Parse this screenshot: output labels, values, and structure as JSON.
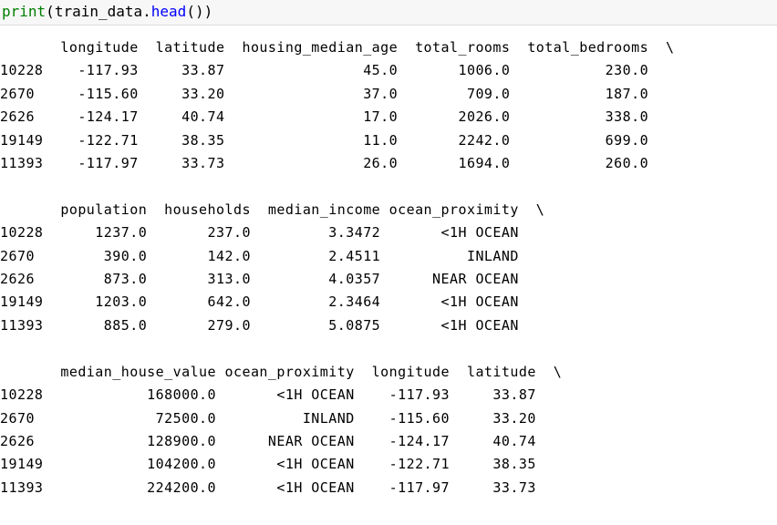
{
  "input": {
    "print": "print",
    "open_paren": "(",
    "obj": "train_data",
    "dot": ".",
    "method": "head",
    "close": "())"
  },
  "output": {
    "blocks": [
      {
        "header": "       longitude  latitude  housing_median_age  total_rooms  total_bedrooms  \\",
        "rows": [
          "10228    -117.93     33.87                45.0       1006.0           230.0   ",
          "2670     -115.60     33.20                37.0        709.0           187.0   ",
          "2626     -124.17     40.74                17.0       2026.0           338.0   ",
          "19149    -122.71     38.35                11.0       2242.0           699.0   ",
          "11393    -117.97     33.73                26.0       1694.0           260.0   "
        ]
      },
      {
        "header": "       population  households  median_income ocean_proximity  \\",
        "rows": [
          "10228      1237.0       237.0         3.3472       <1H OCEAN   ",
          "2670        390.0       142.0         2.4511          INLAND   ",
          "2626        873.0       313.0         4.0357      NEAR OCEAN   ",
          "19149      1203.0       642.0         2.3464       <1H OCEAN   ",
          "11393       885.0       279.0         5.0875       <1H OCEAN   "
        ]
      },
      {
        "header": "       median_house_value ocean_proximity  longitude  latitude  \\",
        "rows": [
          "10228            168000.0       <1H OCEAN    -117.93     33.87   ",
          "2670              72500.0          INLAND    -115.60     33.20   ",
          "2626             128900.0      NEAR OCEAN    -124.17     40.74   ",
          "19149            104200.0       <1H OCEAN    -122.71     38.35   ",
          "11393            224200.0       <1H OCEAN    -117.97     33.73   "
        ]
      }
    ]
  }
}
